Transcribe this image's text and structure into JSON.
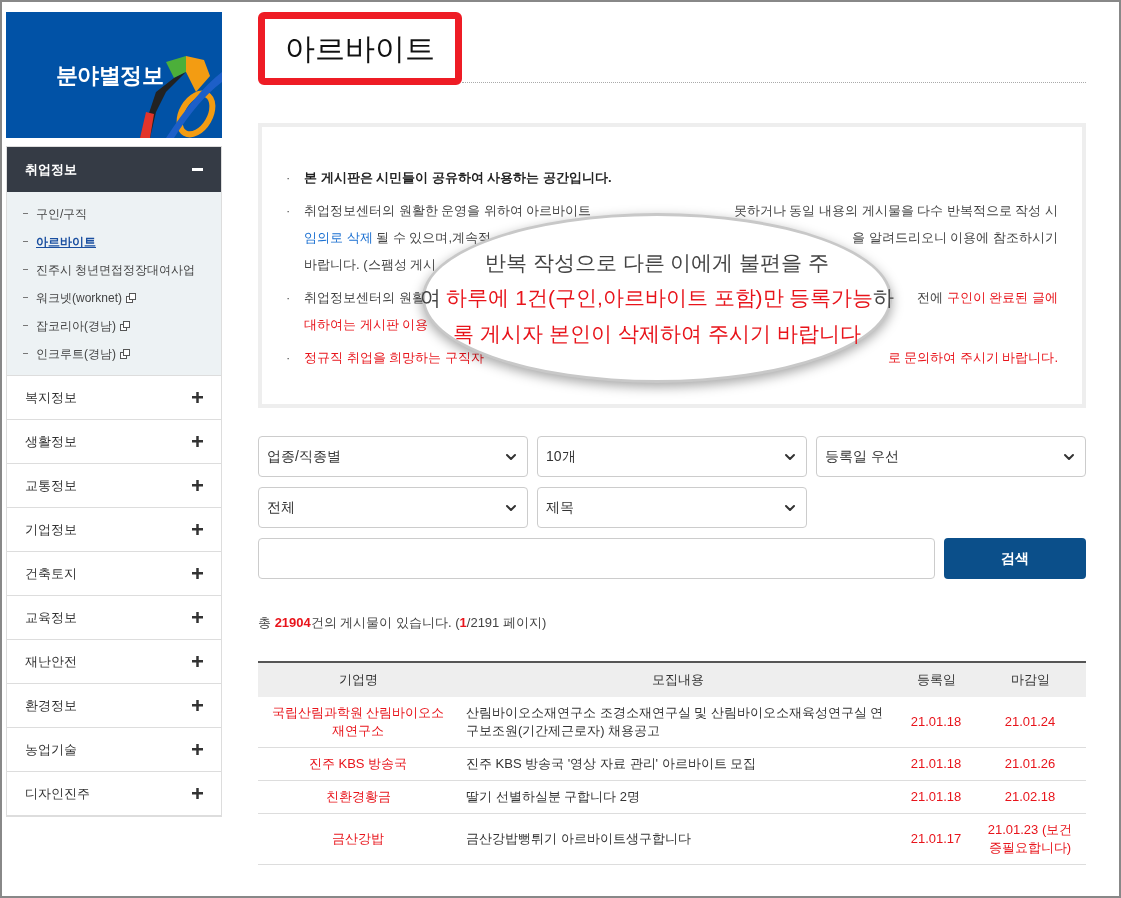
{
  "sidebar": {
    "banner_title": "분야별정보",
    "menus": [
      {
        "label": "취업정보",
        "expanded": true,
        "children": [
          {
            "label": "구인/구직",
            "selected": false,
            "external": false
          },
          {
            "label": "아르바이트",
            "selected": true,
            "external": false
          },
          {
            "label": "진주시 청년면접정장대여사업",
            "selected": false,
            "external": false
          },
          {
            "label": "워크넷(worknet)",
            "selected": false,
            "external": true
          },
          {
            "label": "잡코리아(경남)",
            "selected": false,
            "external": true
          },
          {
            "label": "인크루트(경남)",
            "selected": false,
            "external": true
          }
        ]
      },
      {
        "label": "복지정보",
        "expanded": false
      },
      {
        "label": "생활정보",
        "expanded": false
      },
      {
        "label": "교통정보",
        "expanded": false
      },
      {
        "label": "기업정보",
        "expanded": false
      },
      {
        "label": "건축토지",
        "expanded": false
      },
      {
        "label": "교육정보",
        "expanded": false
      },
      {
        "label": "재난안전",
        "expanded": false
      },
      {
        "label": "환경정보",
        "expanded": false
      },
      {
        "label": "농업기술",
        "expanded": false
      },
      {
        "label": "디자인진주",
        "expanded": false
      }
    ]
  },
  "page_title": "아르바이트",
  "notice": {
    "lines": [
      {
        "bullet": "·",
        "left": [
          {
            "text": "본 게시판은 시민들이 공유하여 사용하는 공간입니다.",
            "kind": "bold"
          }
        ]
      },
      {
        "bullet": "·",
        "left": [
          {
            "text": "취업정보센터의 원활한 운영을 위하여 아르바이트",
            "kind": "normal"
          }
        ],
        "right": [
          {
            "text": "못하거나 동일 내용의 게시물을 다수 반복적으로 작성 시",
            "kind": "normal"
          }
        ]
      },
      {
        "left": [
          {
            "text": "임의로 삭제",
            "kind": "blue"
          },
          {
            "text": " 될 수 있으며,계속적",
            "kind": "normal"
          }
        ],
        "right": [
          {
            "text": "을 알려드리오니 이용에 참조하시기",
            "kind": "normal"
          }
        ]
      },
      {
        "left": [
          {
            "text": "바랍니다. (스팸성 게시",
            "kind": "normal"
          }
        ]
      },
      {
        "bullet": "·",
        "left": [
          {
            "text": "취업정보센터의 원활",
            "kind": "normal"
          }
        ],
        "right": [
          {
            "text": "전에 ",
            "kind": "normal"
          },
          {
            "text": "구인이 완료된 글에",
            "kind": "red"
          }
        ]
      },
      {
        "left": [
          {
            "text": "대하여는 게시판 이용",
            "kind": "red"
          }
        ]
      },
      {
        "bullet": "·",
        "left": [
          {
            "text": "정규직 취업을 희망하는 구직자",
            "kind": "red"
          }
        ],
        "right": [
          {
            "text": "로 문의하여 주시기 바랍니다.",
            "kind": "red"
          }
        ]
      }
    ],
    "magnifier": [
      [
        {
          "text": "반복 작성으로 다른 이에게 불편을 주",
          "kind": "normal"
        }
      ],
      [
        {
          "text": "여 ",
          "kind": "normal"
        },
        {
          "text": "하루에 1건(구인,아르바이트 포함)만 등록가능",
          "kind": "red"
        },
        {
          "text": "하",
          "kind": "normal"
        }
      ],
      [
        {
          "text": "록 게시자 본인이 삭제하여 주시기 바랍니다",
          "kind": "red"
        }
      ]
    ]
  },
  "filters": {
    "row1": [
      "업종/직종별",
      "10개",
      "등록일 우선"
    ],
    "row2": [
      "전체",
      "제목"
    ]
  },
  "search_button": "검색",
  "count": [
    {
      "text": "총 ",
      "kind": "normal"
    },
    {
      "text": "21904",
      "kind": "redb"
    },
    {
      "text": "건의 게시물이 있습니다. (",
      "kind": "normal"
    },
    {
      "text": "1",
      "kind": "redb"
    },
    {
      "text": "/2191 페이지)",
      "kind": "normal"
    }
  ],
  "table": {
    "columns": [
      "기업명",
      "모집내용",
      "등록일",
      "마감일"
    ],
    "rows": [
      [
        "국립산림과학원 산림바이오소재연구소",
        "산림바이오소재연구소 조경소재연구실 및 산림바이오소재육성연구실 연구보조원(기간제근로자) 채용공고",
        "21.01.18",
        "21.01.24"
      ],
      [
        "진주 KBS 방송국",
        "진주 KBS 방송국 '영상 자료 관리' 아르바이트 모집",
        "21.01.18",
        "21.01.26"
      ],
      [
        "친환경황금",
        "딸기 선별하실분 구합니다 2명",
        "21.01.18",
        "21.02.18"
      ],
      [
        "금산강밥",
        "금산강밥뻥튀기 아르바이트생구합니다",
        "21.01.17",
        "21.01.23 (보건증필요합니다)"
      ]
    ]
  }
}
